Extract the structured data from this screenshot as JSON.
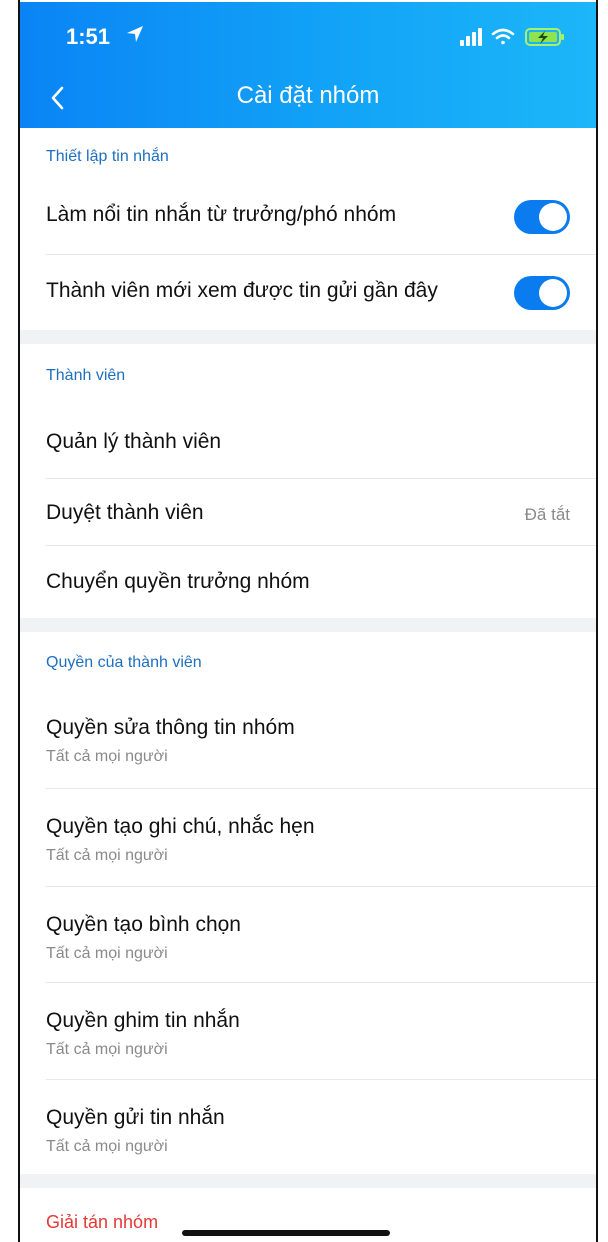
{
  "status_bar": {
    "time": "1:51"
  },
  "nav": {
    "title": "Cài đặt nhóm",
    "back_icon": "chevron-left-icon"
  },
  "sections": {
    "messages": {
      "label": "Thiết lập tin nhắn",
      "items": [
        {
          "label": "Làm nổi tin nhắn từ trưởng/phó nhóm",
          "enabled": true
        },
        {
          "label": "Thành viên mới xem được tin gửi gần đây",
          "enabled": true
        }
      ]
    },
    "members": {
      "label": "Thành viên",
      "items": [
        {
          "label": "Quản lý thành viên"
        },
        {
          "label": "Duyệt thành viên",
          "value": "Đã tắt"
        },
        {
          "label": "Chuyển quyền trưởng nhóm"
        }
      ]
    },
    "permissions": {
      "label": "Quyền của thành viên",
      "items": [
        {
          "label": "Quyền sửa thông tin nhóm",
          "value": "Tất cả mọi người"
        },
        {
          "label": "Quyền tạo ghi chú, nhắc hẹn",
          "value": "Tất cả mọi người"
        },
        {
          "label": "Quyền tạo bình chọn",
          "value": "Tất cả mọi người"
        },
        {
          "label": "Quyền ghim tin nhắn",
          "value": "Tất cả mọi người"
        },
        {
          "label": "Quyền gửi tin nhắn",
          "value": "Tất cả mọi người"
        }
      ]
    }
  },
  "danger": {
    "disband_label": "Giải tán nhóm"
  },
  "colors": {
    "header_start": "#0a84f5",
    "header_end": "#1cb6f9",
    "section_label": "#1f6fc0",
    "toggle_on": "#0a7cf0",
    "danger": "#e53935"
  }
}
